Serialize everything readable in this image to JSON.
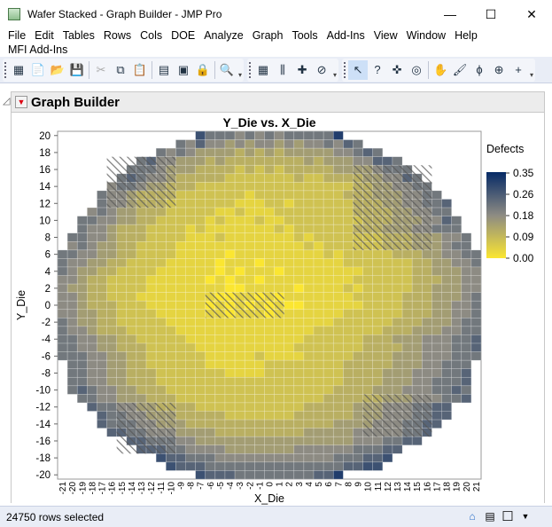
{
  "window": {
    "title": "Wafer Stacked - Graph Builder - JMP Pro",
    "minimize": "—",
    "maximize": "☐",
    "close": "✕"
  },
  "menu": [
    "File",
    "Edit",
    "Tables",
    "Rows",
    "Cols",
    "DOE",
    "Analyze",
    "Graph",
    "Tools",
    "Add-Ins",
    "View",
    "Window",
    "Help"
  ],
  "menu2": "MFI Add-Ins",
  "toolbar": {
    "g1": [
      [
        "new-data-table-icon",
        "▦"
      ],
      [
        "new-script-icon",
        "📄"
      ],
      [
        "open-icon",
        "📂"
      ],
      [
        "save-icon",
        "💾"
      ],
      "|",
      [
        "cut-icon",
        "✂",
        1
      ],
      [
        "copy-icon",
        "⧉"
      ],
      [
        "paste-icon",
        "📋"
      ],
      "|",
      [
        "data-view-icon",
        "▤"
      ],
      [
        "layout-icon",
        "▣"
      ],
      [
        "lock-icon",
        "🔒",
        1
      ],
      "|",
      [
        "search-icon",
        "🔍"
      ]
    ],
    "g2": [
      [
        "data-grid-icon",
        "▦"
      ],
      [
        "columns-icon",
        "⫼"
      ],
      [
        "add-graph-icon",
        "✚"
      ],
      [
        "compass-icon",
        "⊘"
      ]
    ],
    "g3": [
      [
        "arrow-icon",
        "↖",
        0,
        1
      ],
      [
        "help-icon",
        "?"
      ],
      [
        "crosshair-icon",
        "✜"
      ],
      [
        "target-icon",
        "◎"
      ],
      "|",
      [
        "hand-icon",
        "✋"
      ],
      [
        "brush-icon",
        "🖌"
      ],
      [
        "lasso-icon",
        "ϕ"
      ],
      [
        "zoom-icon",
        "⊕"
      ],
      [
        "plus-icon",
        "+"
      ]
    ]
  },
  "graph_builder": {
    "title": "Graph Builder"
  },
  "chart_data": {
    "type": "heatmap",
    "title": "Y_Die vs. X_Die",
    "xlabel": "X_Die",
    "ylabel": "Y_Die",
    "xlim": [
      -21,
      21
    ],
    "ylim": [
      -20,
      20
    ],
    "yticks": [
      20,
      18,
      16,
      14,
      12,
      10,
      8,
      6,
      4,
      2,
      0,
      -2,
      -4,
      -6,
      -8,
      -10,
      -12,
      -14,
      -16,
      -18,
      -20
    ],
    "xticks": [
      -21,
      -20,
      -19,
      -18,
      -17,
      -16,
      -15,
      -14,
      -13,
      -12,
      -11,
      -10,
      -9,
      -8,
      -7,
      -6,
      -5,
      -4,
      -3,
      -2,
      -1,
      0,
      1,
      2,
      3,
      4,
      5,
      6,
      7,
      8,
      9,
      10,
      11,
      12,
      13,
      14,
      15,
      16,
      17,
      18,
      19,
      20,
      21
    ],
    "value_per_level": 0.035,
    "rows_note_y_from": 20,
    "rows": [
      "866656565666669",
      "6575545455454556576",
      "65654444343434444455676",
      "675544434333333334344455776",
      "66654443333232323333344445666",
      "6765543333322222223223333445576",
      "566544333222222222222222233445566",
      "65543333222222212222222223334445566",
      "6554333222222211122122222233344556 67",
      "5654433322222112111222222223333445566",
      "665544332222212111211222222223334445576",
      "655433322221211111112122222233344455666",
      "66554333222211121111111212222222333444556",
      "56544332222111111111111121222222333444566",
      "6655443322221111101111111112122222333445566",
      "6554433222211111011101111111122222223344556 6",
      "6544332222111111010111011111111222223344 4556",
      "5543322221111110101101111111112222223334455 6",
      "5443322221111111100111110111121222223344455",
      "5543322211111111001101011111112222233344456",
      "5543332221111110101010100111111222233344556",
      "5544332222111111101110111111122222233344556",
      "6544332222211111111111111111222222333444566",
      "6554333222221111111111111122222223334445566",
      "6655443322222111111111111222222333444555667",
      "6655443332222211111111112222222333344555667",
      "6665544332222221111121111222223333444555666",
      "66554433222222111111222222223333344455666",
      "66554433322222221111222222223333444555667",
      "665544333222222222222222222233334445 56667",
      "676554433322222222222222222333344455 56676",
      "6655444333222222222222222333333444555667",
      "7665544333322222222222333334445556677",
      "76655444333332222222333333444555 66 77",
      "766655444333333333333333444455566 77",
      "7766555444433333333344444555556 67",
      "77666554444444444444444555 6677",
      "777665555444444455555566 677",
      "87766655555555555566677 8",
      "8777666666666666667788",
      "877766666666779"
    ],
    "hatched_regions": [
      {
        "x": [
          -16,
          -10
        ],
        "y": [
          12,
          17
        ]
      },
      {
        "x": [
          9,
          16
        ],
        "y": [
          7,
          16
        ]
      },
      {
        "x": [
          -6,
          1
        ],
        "y": [
          -1,
          1
        ]
      },
      {
        "x": [
          -15,
          -10
        ],
        "y": [
          -17,
          -12
        ]
      },
      {
        "x": [
          10,
          16
        ],
        "y": [
          -15,
          -11
        ]
      }
    ],
    "legend": {
      "title": "Defects",
      "ticks": [
        "0.35",
        "0.26",
        "0.18",
        "0.09",
        "0.00"
      ],
      "range": [
        0,
        0.35
      ],
      "placement": "right"
    },
    "colors": {
      "low": "#fbe631",
      "mid": "#8d8b83",
      "high": "#062a66"
    }
  },
  "status": {
    "text": "24750 rows selected"
  }
}
